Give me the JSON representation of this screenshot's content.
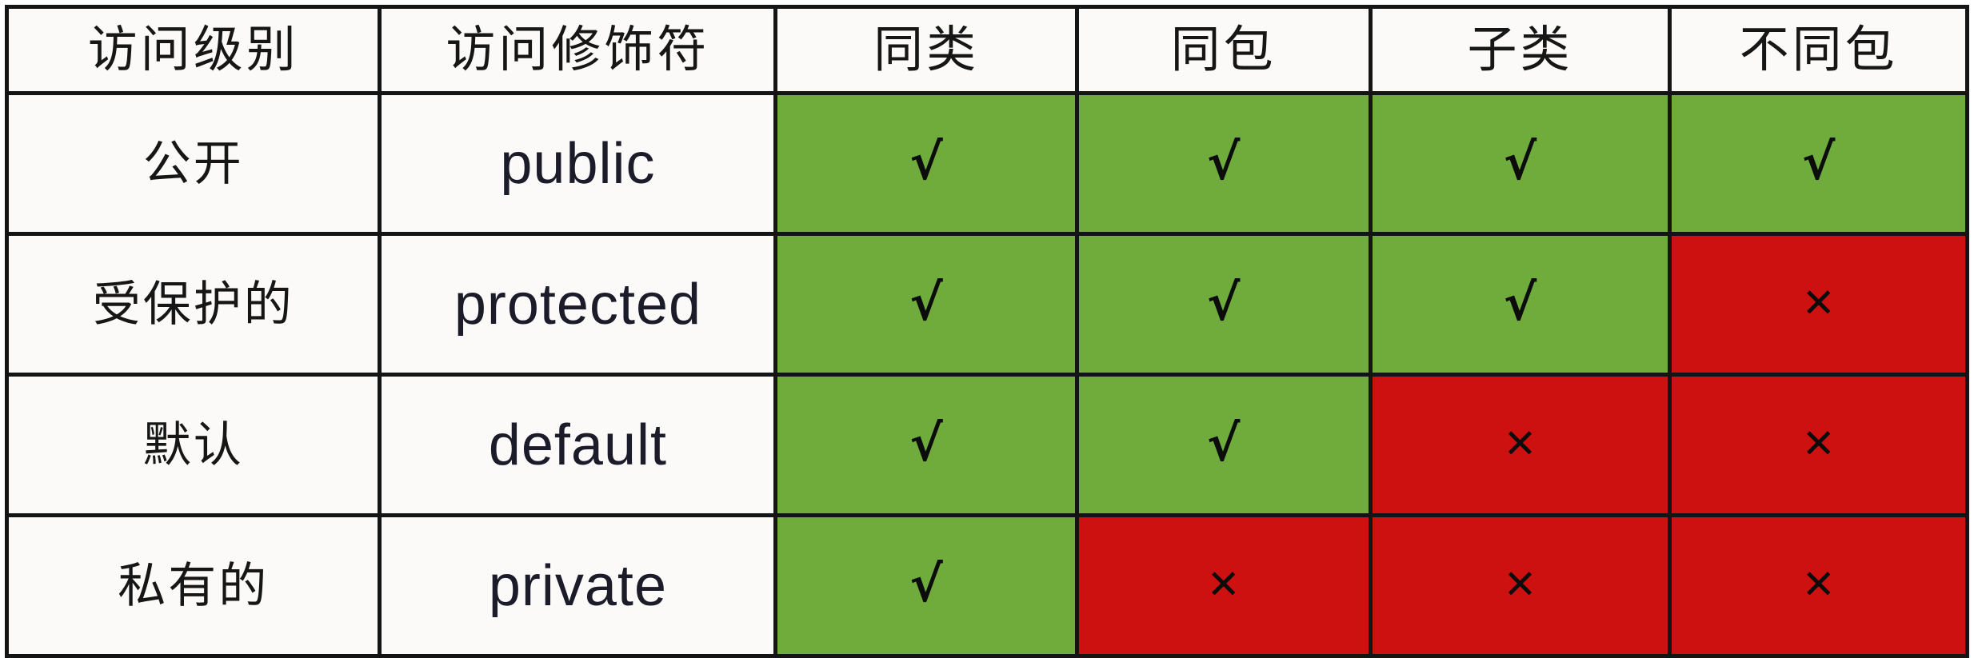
{
  "table": {
    "columns": [
      {
        "key": "level",
        "label": "访问级别",
        "type": "text"
      },
      {
        "key": "modifier",
        "label": "访问修饰符",
        "type": "code"
      },
      {
        "key": "same_class",
        "label": "同类",
        "type": "status"
      },
      {
        "key": "same_package",
        "label": "同包",
        "type": "status"
      },
      {
        "key": "subclass",
        "label": "子类",
        "type": "status"
      },
      {
        "key": "diff_package",
        "label": "不同包",
        "type": "status"
      }
    ],
    "rows": [
      {
        "level": "公开",
        "modifier": "public",
        "status": [
          "allow",
          "allow",
          "allow",
          "allow"
        ]
      },
      {
        "level": "受保护的",
        "modifier": "protected",
        "status": [
          "allow",
          "allow",
          "allow",
          "deny"
        ]
      },
      {
        "level": "默认",
        "modifier": "default",
        "status": [
          "allow",
          "allow",
          "deny",
          "deny"
        ]
      },
      {
        "level": "私有的",
        "modifier": "private",
        "status": [
          "allow",
          "deny",
          "deny",
          "deny"
        ]
      }
    ]
  },
  "glyphs": {
    "allow": "√",
    "deny": "✕",
    "allow_icon_name": "checkmark-icon",
    "deny_icon_name": "cross-icon"
  },
  "colors": {
    "allow_background": "#6fac3c",
    "deny_background": "#cd1010",
    "cell_background": "#fbfaf8",
    "border": "#141414",
    "text": "#161616"
  }
}
